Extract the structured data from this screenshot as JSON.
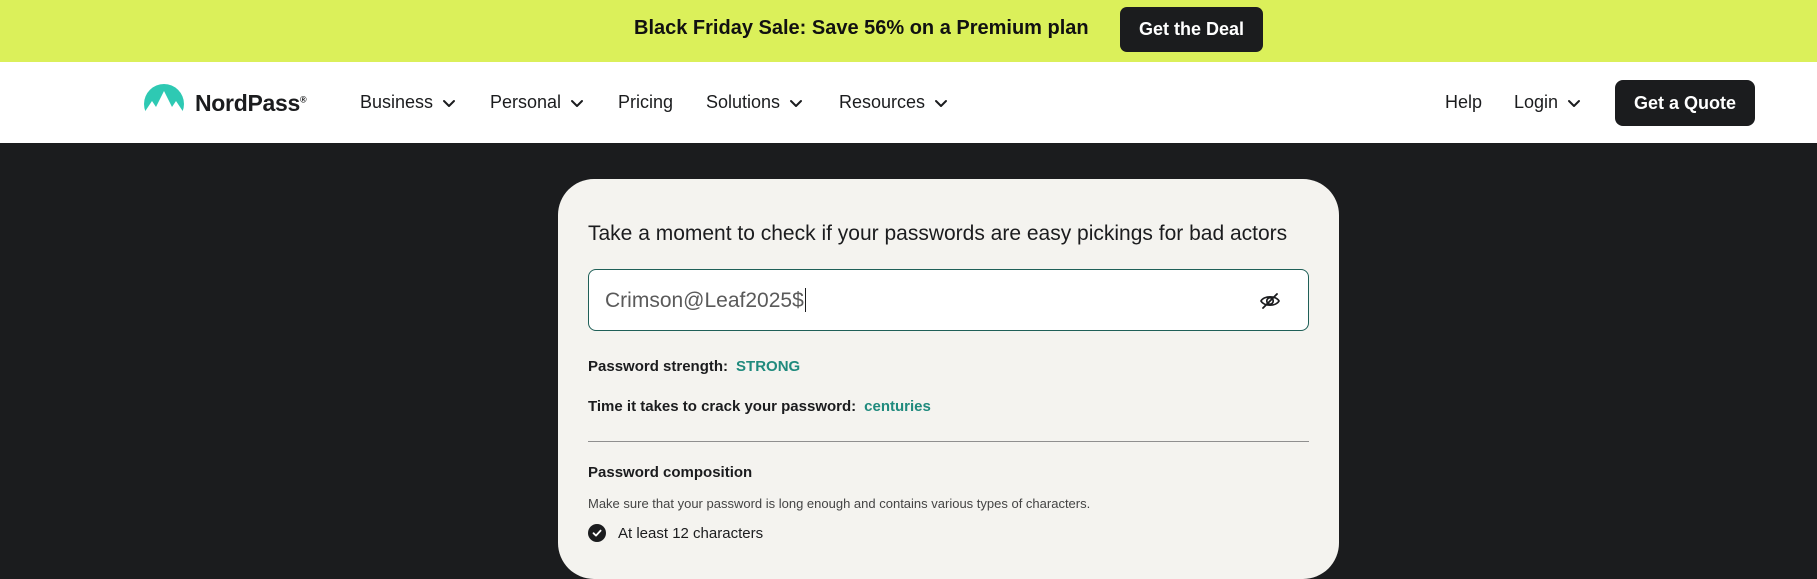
{
  "promo": {
    "text": "Black Friday Sale: Save 56% on a Premium plan",
    "button_label": "Get the Deal"
  },
  "nav": {
    "brand": "NordPass",
    "brand_mark": "®",
    "items": [
      {
        "label": "Business",
        "has_dropdown": true
      },
      {
        "label": "Personal",
        "has_dropdown": true
      },
      {
        "label": "Pricing",
        "has_dropdown": false
      },
      {
        "label": "Solutions",
        "has_dropdown": true
      },
      {
        "label": "Resources",
        "has_dropdown": true
      }
    ],
    "help_label": "Help",
    "login_label": "Login",
    "quote_label": "Get a Quote"
  },
  "checker": {
    "heading": "Take a moment to check if your passwords are easy pickings for bad actors",
    "password_value": "Crimson@Leaf2025$",
    "strength_label": "Password strength:",
    "strength_value": "STRONG",
    "crack_label": "Time it takes to crack your password:",
    "crack_value": "centuries",
    "composition_title": "Password composition",
    "composition_desc": "Make sure that your password is long enough and contains various types of characters.",
    "criteria": [
      {
        "label": "At least 12 characters",
        "met": true
      }
    ]
  },
  "colors": {
    "promo_bg": "#dbf05a",
    "accent_teal": "#1f8a7d",
    "dark": "#1b1c1e",
    "card_bg": "#f4f3ef"
  },
  "icons": {
    "logo": "nordpass-mountain-logo",
    "visibility": "eye-slash-icon",
    "dropdown": "chevron-down-icon",
    "criteria": "check-circle-icon"
  }
}
